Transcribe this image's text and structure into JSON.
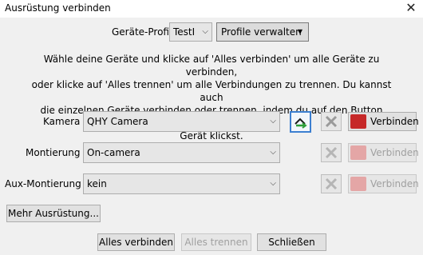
{
  "window": {
    "title": "Ausrüstung verbinden"
  },
  "profile": {
    "label": "Geräte-Profil",
    "value": "TestI",
    "manage_label": "Profile verwalten"
  },
  "description": [
    "Wähle deine Geräte und klicke auf 'Alles verbinden' um alle Geräte zu verbinden,",
    "oder klicke  auf 'Alles trennen' um alle  Verbindungen zu trennen. Du kannst auch",
    "die einzelnen Geräte verbinden oder trennen, indem du auf den Button neben dem",
    "Gerät klickst."
  ],
  "devices": [
    {
      "label": "Kamera",
      "value": "QHY Camera",
      "connect_label": "Verbinden",
      "enabled": true
    },
    {
      "label": "Montierung",
      "value": "On-camera",
      "connect_label": "Verbinden",
      "enabled": false
    },
    {
      "label": "Aux-Montierung",
      "value": "kein",
      "connect_label": "Verbinden",
      "enabled": false
    }
  ],
  "buttons": {
    "more": "Mehr Ausrüstung...",
    "connect_all": "Alles verbinden",
    "disconnect_all": "Alles trennen",
    "close": "Schließen"
  },
  "colors": {
    "accent": "#3c7fd0",
    "connect_icon": "#c62828",
    "swap_arrow": "#2e9e3a"
  }
}
